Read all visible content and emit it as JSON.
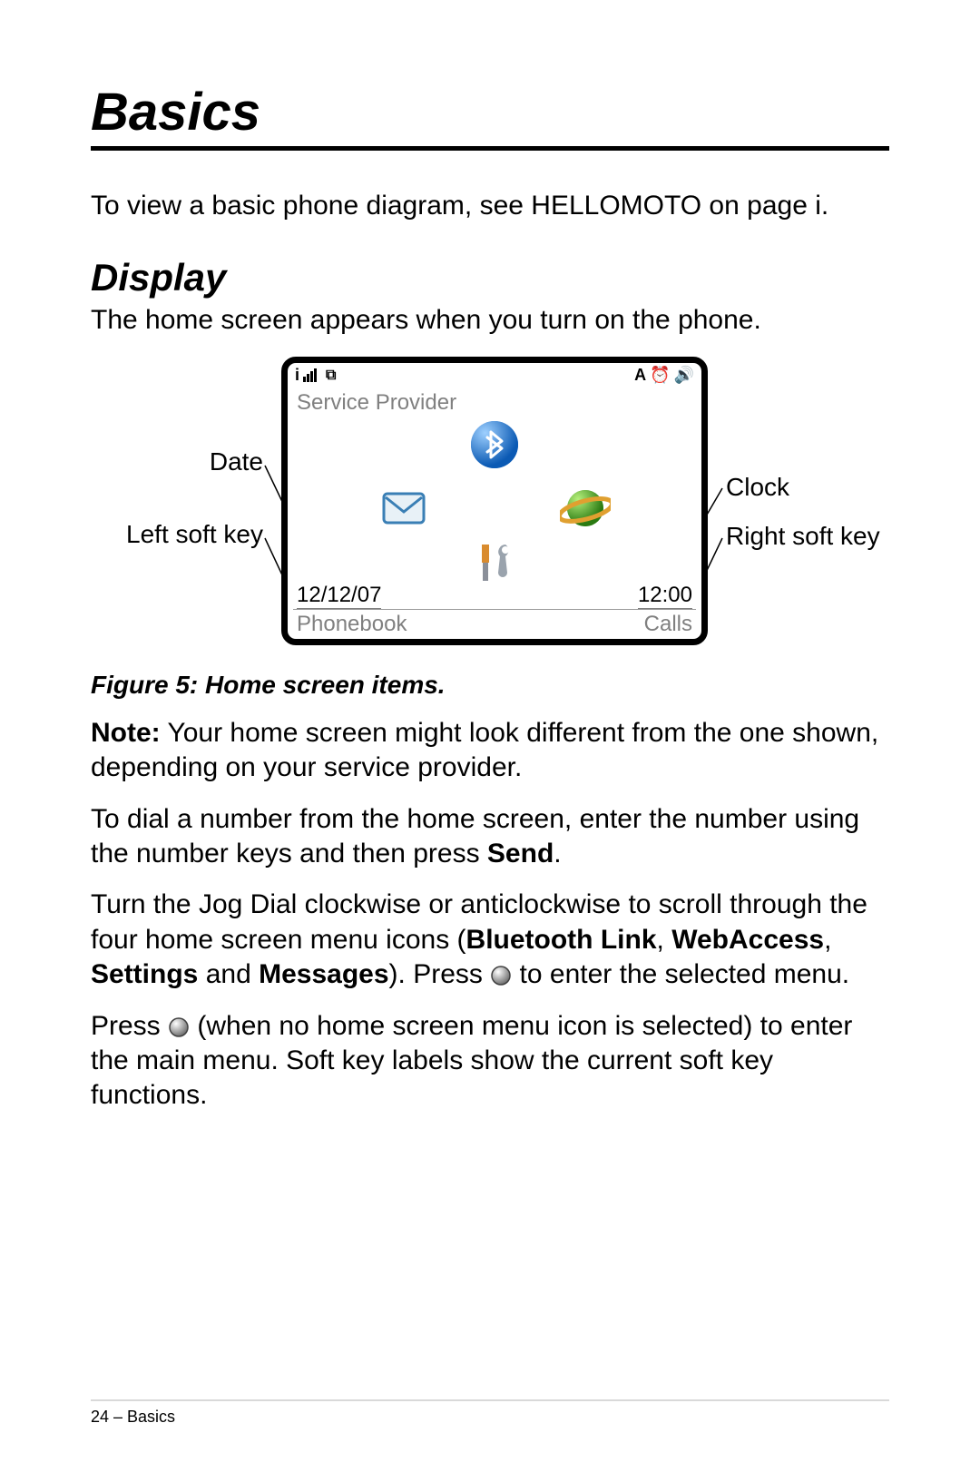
{
  "chapter_title": "Basics",
  "intro_line": "To view a basic phone diagram, see HELLOMOTO on page i.",
  "section_title": "Display",
  "section_lead": "The home screen appears when you turn on the phone.",
  "figure": {
    "callouts": {
      "date": "Date",
      "left_soft_key": "Left soft key",
      "clock": "Clock",
      "right_soft_key": "Right soft key"
    },
    "screen": {
      "status_left": "",
      "status_right": "A",
      "service_provider": "Service Provider",
      "date": "12/12/07",
      "time": "12:00",
      "left_softkey": "Phonebook",
      "right_softkey": "Calls"
    },
    "caption": "Figure 5: Home screen items."
  },
  "note_prefix": "Note:",
  "note_body": " Your home screen might look different from the one shown, depending on your service provider.",
  "dial_line_1": "To dial a number from the home screen, enter the number using the number keys and then press ",
  "dial_send": "Send",
  "dial_line_1_suffix": ".",
  "jog_line_a": "Turn the Jog Dial clockwise or anticlockwise to scroll through the four home screen menu icons (",
  "jog_bold_1": "Bluetooth Link",
  "jog_sep1": ", ",
  "jog_bold_2": "WebAccess",
  "jog_sep2": ", ",
  "jog_bold_3": "Settings",
  "jog_sep3": " and ",
  "jog_bold_4": "Messages",
  "jog_line_b": "). Press ",
  "jog_line_c": " to enter the selected menu.",
  "press_line_a": "Press ",
  "press_line_b": " (when no home screen menu icon is selected) to enter the main menu. Soft key labels show the current soft key functions.",
  "footer": "24 – Basics"
}
